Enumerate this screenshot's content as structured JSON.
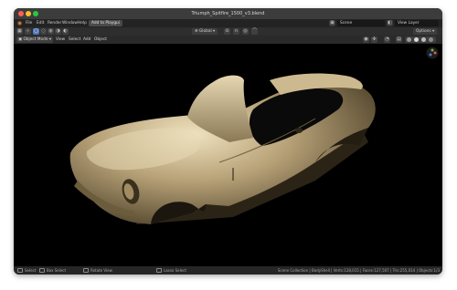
{
  "window": {
    "title": "Triumph_Spitfire_1500_v3.blend",
    "traffic_lights": [
      "#ff5f57",
      "#febc2e",
      "#28c840"
    ]
  },
  "menubar": {
    "logo_icon": "blender-logo-icon",
    "items": [
      "File",
      "Edit",
      "Render",
      "Window",
      "Help"
    ],
    "workspace_tab": "Add to Playgui",
    "scene_label": "Scene",
    "view_layer_label": "View Layer"
  },
  "toolbar": {
    "icons": [
      "cursor-icon",
      "move-icon",
      "select-box-icon",
      "select-circle-icon",
      "select-lasso-icon",
      "select-invert-icon",
      "select-extend-icon"
    ],
    "orientation": "Global",
    "pivot_icon": "pivot-icon",
    "snap_icon": "magnet-icon",
    "proportional_icon": "proportional-icon",
    "options_label": "Options"
  },
  "header": {
    "mode": "Object Mode",
    "menus": [
      "View",
      "Select",
      "Add",
      "Object"
    ],
    "shading_colors": [
      "#9e9e9e",
      "#d9d9d9",
      "#bdbdbd",
      "#8c8c8c"
    ]
  },
  "viewport": {
    "background": "#000000",
    "model_color": "#b8a278",
    "gizmo_icon": "navigation-gizmo-icon"
  },
  "statusbar": {
    "select_label": "Select",
    "box_select_label": "Box Select",
    "rotate_view_label": "Rotate View",
    "context_menu_label": "Lasso Select",
    "stats": "Scene Collection | BodyShell | Verts:128,015 | Faces:127,507 | Tris:255,014 | Objects:1/3"
  }
}
